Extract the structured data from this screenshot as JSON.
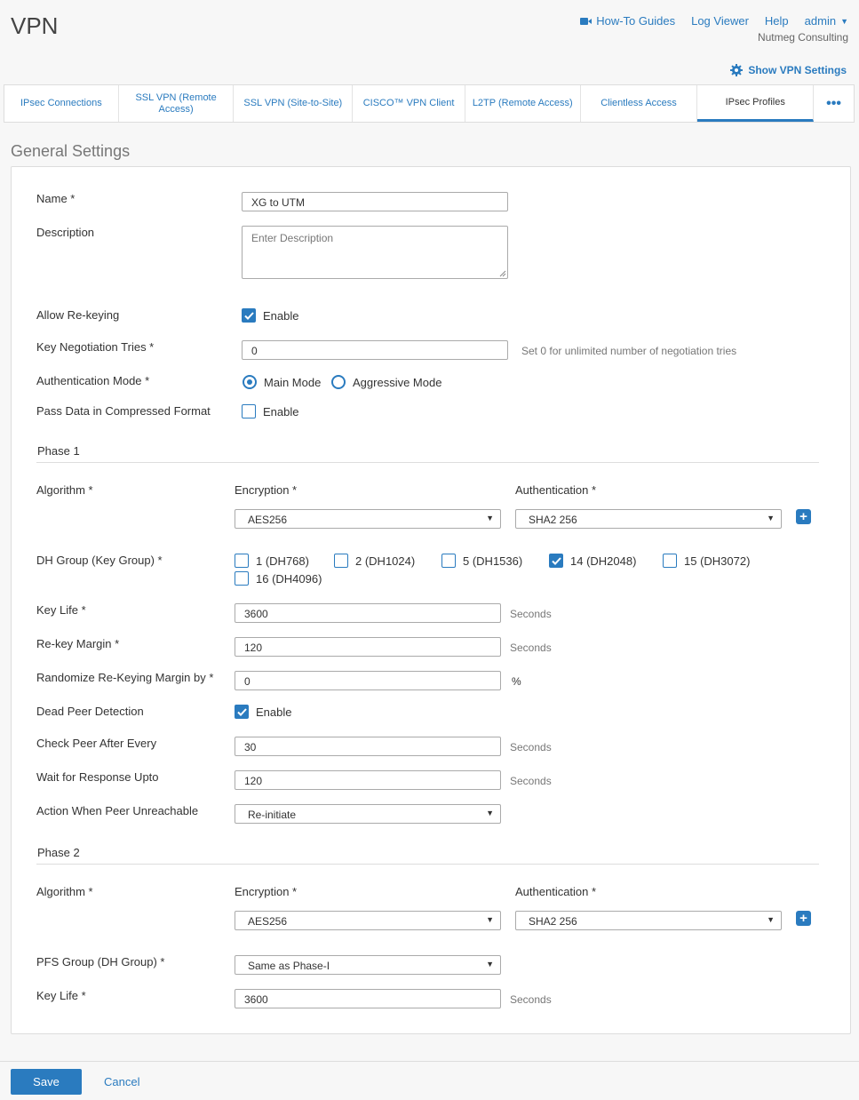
{
  "app": {
    "title": "VPN"
  },
  "header": {
    "links": {
      "howto": "How-To Guides",
      "logviewer": "Log Viewer",
      "help": "Help",
      "admin": "admin"
    },
    "org": "Nutmeg Consulting",
    "show_settings": "Show VPN Settings"
  },
  "tabs": [
    {
      "label": "IPsec Connections"
    },
    {
      "label": "SSL VPN (Remote Access)"
    },
    {
      "label": "SSL VPN (Site-to-Site)"
    },
    {
      "label": "CISCO™ VPN Client"
    },
    {
      "label": "L2TP (Remote Access)"
    },
    {
      "label": "Clientless Access"
    },
    {
      "label": "IPsec Profiles"
    },
    {
      "label": "•••"
    }
  ],
  "section": {
    "title": "General Settings"
  },
  "general": {
    "name_label": "Name *",
    "name_value": "XG to UTM",
    "description_label": "Description",
    "description_placeholder": "Enter Description",
    "rekey_label": "Allow Re-keying",
    "rekey_option": "Enable",
    "tries_label": "Key Negotiation Tries *",
    "tries_value": "0",
    "tries_hint": "Set 0 for unlimited number of negotiation tries",
    "auth_mode_label": "Authentication Mode *",
    "main_mode": "Main Mode",
    "aggressive_mode": "Aggressive Mode",
    "compress_label": "Pass Data in Compressed Format",
    "compress_option": "Enable"
  },
  "phase1": {
    "title": "Phase 1",
    "algorithm_label": "Algorithm *",
    "encryption_label": "Encryption *",
    "authentication_label": "Authentication *",
    "encryption_value": "AES256",
    "authentication_value": "SHA2 256",
    "dh_label": "DH Group (Key Group) *",
    "dh_options": [
      {
        "label": "1 (DH768)",
        "checked": false
      },
      {
        "label": "2 (DH1024)",
        "checked": false
      },
      {
        "label": "5 (DH1536)",
        "checked": false
      },
      {
        "label": "14 (DH2048)",
        "checked": true
      },
      {
        "label": "15 (DH3072)",
        "checked": false
      },
      {
        "label": "16 (DH4096)",
        "checked": false
      }
    ],
    "keylife_label": "Key Life *",
    "keylife_value": "3600",
    "keylife_unit": "Seconds",
    "rekey_margin_label": "Re-key Margin *",
    "rekey_margin_value": "120",
    "rekey_margin_unit": "Seconds",
    "randomize_label": "Randomize Re-Keying Margin by *",
    "randomize_value": "0",
    "randomize_unit": "%",
    "dpd_label": "Dead Peer Detection",
    "dpd_option": "Enable",
    "check_peer_label": "Check Peer After Every",
    "check_peer_value": "30",
    "check_peer_unit": "Seconds",
    "wait_label": "Wait for Response Upto",
    "wait_value": "120",
    "wait_unit": "Seconds",
    "action_label": "Action When Peer Unreachable",
    "action_value": "Re-initiate"
  },
  "phase2": {
    "title": "Phase 2",
    "algorithm_label": "Algorithm *",
    "encryption_label": "Encryption *",
    "authentication_label": "Authentication *",
    "encryption_value": "AES256",
    "authentication_value": "SHA2 256",
    "pfs_label": "PFS Group (DH Group) *",
    "pfs_value": "Same as Phase-I",
    "keylife_label": "Key Life *",
    "keylife_value": "3600",
    "keylife_unit": "Seconds"
  },
  "footer": {
    "save": "Save",
    "cancel": "Cancel"
  }
}
